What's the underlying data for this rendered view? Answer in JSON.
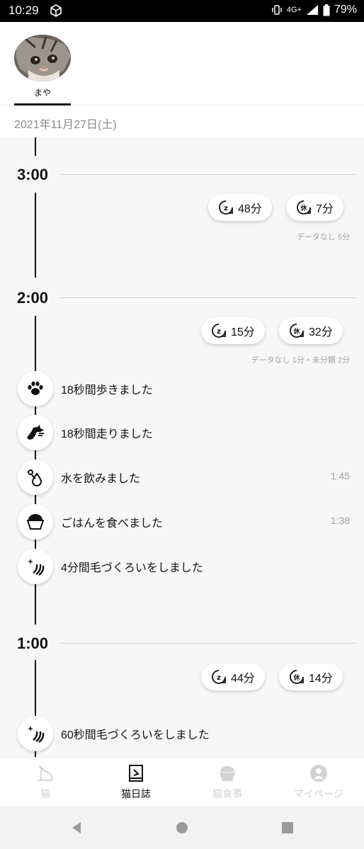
{
  "status_bar": {
    "time": "10:29",
    "network": "4G+",
    "battery": "79%"
  },
  "cat": {
    "name": "まや"
  },
  "date": "2021年11月27日(土)",
  "timeline": [
    {
      "hour": "3:00",
      "sleep": "48分",
      "rest": "7分",
      "note": "データなし 5分",
      "events": []
    },
    {
      "hour": "2:00",
      "sleep": "15分",
      "rest": "32分",
      "note": "データなし 1分・未分類 2分",
      "events": [
        {
          "icon": "paw-icon",
          "text": "18秒間歩きました",
          "time": ""
        },
        {
          "icon": "running-cat-icon",
          "text": "18秒間走りました",
          "time": ""
        },
        {
          "icon": "water-drop-icon",
          "text": "水を飲みました",
          "time": "1:45"
        },
        {
          "icon": "food-bowl-icon",
          "text": "ごはんを食べました",
          "time": "1:38"
        },
        {
          "icon": "grooming-icon",
          "text": "4分間毛づくろいをしました",
          "time": ""
        }
      ]
    },
    {
      "hour": "1:00",
      "sleep": "44分",
      "rest": "14分",
      "note": "",
      "events": [
        {
          "icon": "grooming-icon",
          "text": "60秒間毛づくろいをしました",
          "time": ""
        }
      ]
    }
  ],
  "bottom_nav": [
    {
      "label": "猫",
      "icon": "cat-icon",
      "active": false
    },
    {
      "label": "猫日誌",
      "icon": "diary-icon",
      "active": true
    },
    {
      "label": "猫食事",
      "icon": "food-bowl-icon",
      "active": false
    },
    {
      "label": "マイページ",
      "icon": "user-icon",
      "active": false
    }
  ],
  "colors": {
    "accent": "#111111",
    "inactive": "#d2d2d2",
    "timeline_bg": "#f7f7f7",
    "note_text": "#a2a2a2"
  }
}
